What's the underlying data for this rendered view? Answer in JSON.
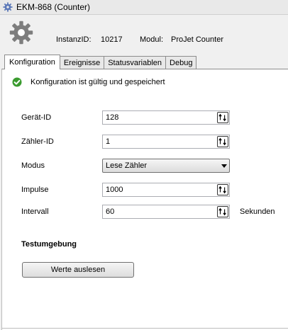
{
  "window": {
    "title": "EKM-868 (Counter)",
    "icon": "gear-icon"
  },
  "header": {
    "icon": "gear-icon",
    "instance_label": "InstanzID:",
    "instance_value": "10217",
    "module_label": "Modul:",
    "module_value": "ProJet Counter"
  },
  "tabs": [
    {
      "label": "Konfiguration",
      "active": true
    },
    {
      "label": "Ereignisse",
      "active": false
    },
    {
      "label": "Statusvariablen",
      "active": false
    },
    {
      "label": "Debug",
      "active": false
    }
  ],
  "status": {
    "text": "Konfiguration ist gültig und gespeichert",
    "icon": "check-circle-icon",
    "color": "#3a9b2f"
  },
  "form": {
    "device_id": {
      "label": "Gerät-ID",
      "value": "128"
    },
    "counter_id": {
      "label": "Zähler-ID",
      "value": "1"
    },
    "mode": {
      "label": "Modus",
      "value": "Lese Zähler"
    },
    "pulses": {
      "label": "Impulse",
      "value": "1000"
    },
    "interval": {
      "label": "Intervall",
      "value": "60",
      "unit": "Sekunden"
    }
  },
  "test": {
    "heading": "Testumgebung",
    "read_button": "Werte auslesen"
  }
}
